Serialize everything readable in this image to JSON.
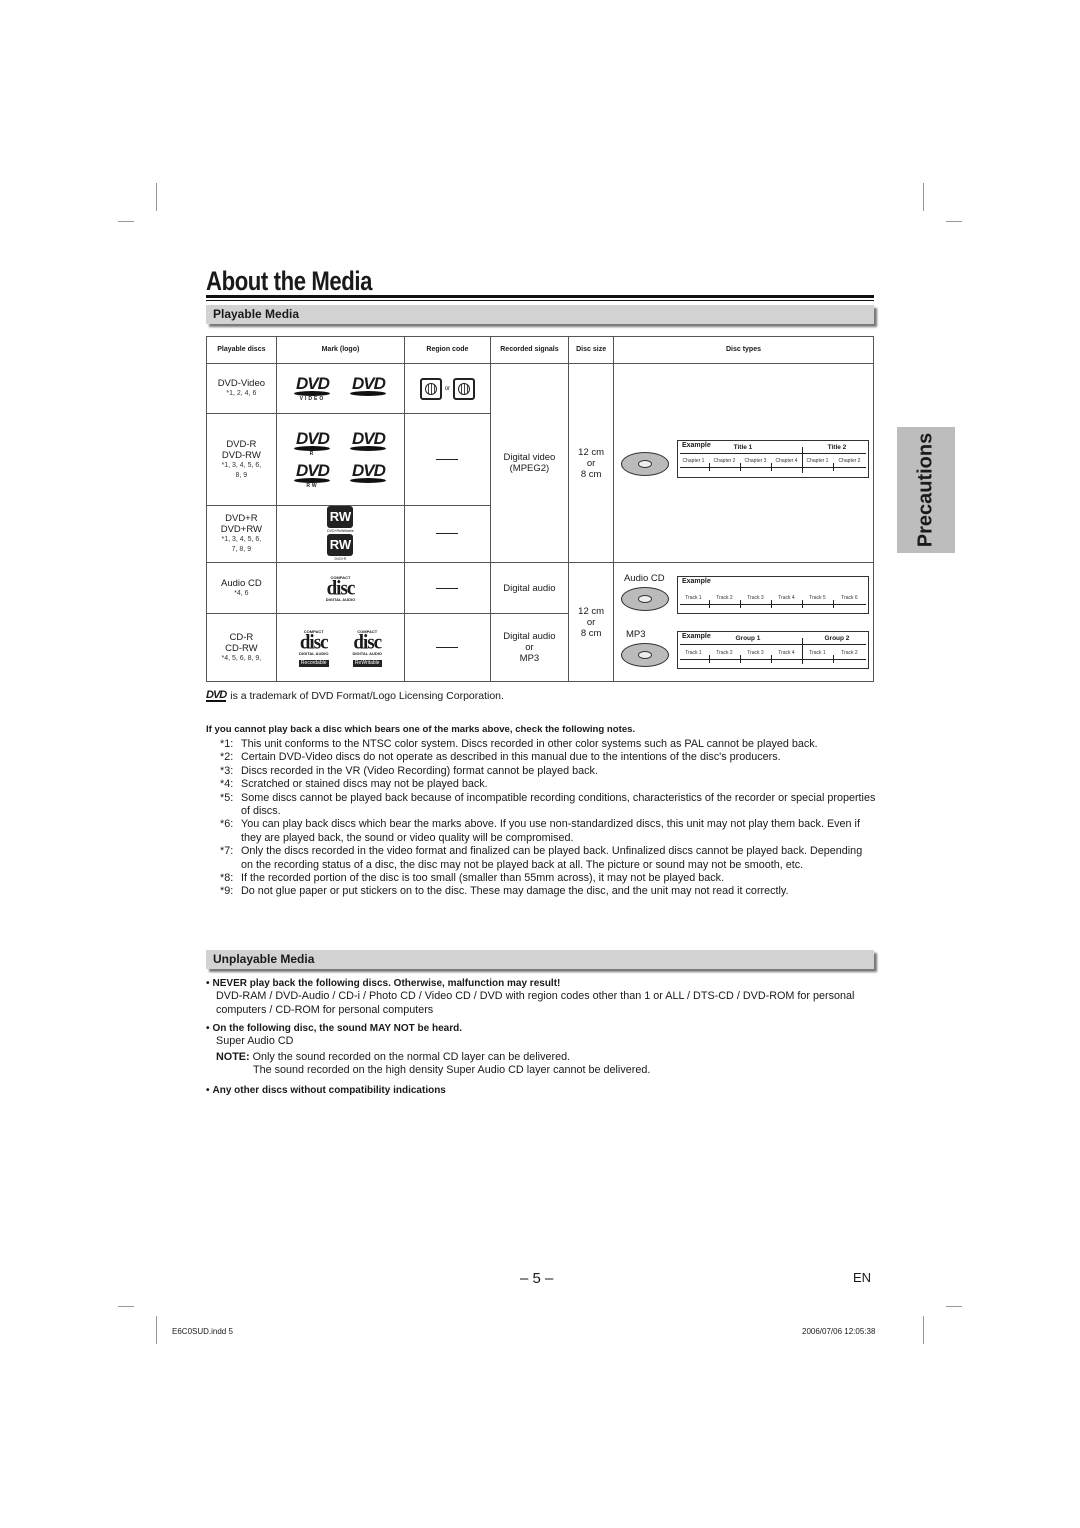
{
  "page": {
    "title": "About the Media",
    "side_tab": "Precautions",
    "page_number": "– 5 –",
    "language": "EN",
    "footer_file": "E6C0SUD.indd   5",
    "footer_timestamp": "2006/07/06   12:05:38"
  },
  "playable": {
    "heading": "Playable Media",
    "columns": [
      "Playable discs",
      "Mark (logo)",
      "Region code",
      "Recorded signals",
      "Disc size",
      "Disc types"
    ],
    "rows": [
      {
        "name": "DVD-Video",
        "notes": "*1, 2, 4, 6",
        "logos": [
          "DVD VIDEO",
          "DVD VIDEO"
        ],
        "region": [
          "1",
          "ALL"
        ],
        "region_or": "or"
      },
      {
        "name": "DVD-R\nDVD-RW",
        "name1": "DVD-R",
        "name2": "DVD-RW",
        "notes1": "*1, 3, 4, 5, 6,",
        "notes2": "8, 9",
        "logos": [
          "DVD R",
          "DVD R",
          "DVD RW",
          "DVD RW"
        ],
        "region": "—"
      },
      {
        "name1": "DVD+R",
        "name2": "DVD+RW",
        "notes1": "*1, 3, 4, 5, 6,",
        "notes2": "7, 8, 9",
        "logos": [
          "RW",
          "RW"
        ],
        "logo_captions": [
          "DVD+ReWritable",
          "DVD+R"
        ],
        "region": "—"
      },
      {
        "name": "Audio CD",
        "notes": "*4, 6",
        "logo": {
          "top": "COMPACT",
          "mid": "disc",
          "bottom": "DIGITAL AUDIO"
        },
        "region": "—",
        "signals": "Digital audio"
      },
      {
        "name1": "CD-R",
        "name2": "CD-RW",
        "notes": "*4, 5, 6, 8, 9,",
        "logos": [
          {
            "top": "COMPACT",
            "mid": "disc",
            "bottom": "DIGITAL AUDIO",
            "badge": "Recordable"
          },
          {
            "top": "COMPACT",
            "mid": "disc",
            "bottom": "DIGITAL AUDIO",
            "badge": "ReWritable"
          }
        ],
        "region": "—",
        "signals1": "Digital audio",
        "signals2": "or",
        "signals3": "MP3"
      }
    ],
    "dvd_signals": [
      "Digital video",
      "(MPEG2)"
    ],
    "dvd_size": [
      "12 cm",
      "or",
      "8 cm"
    ],
    "cd_size": [
      "12 cm",
      "or",
      "8 cm"
    ],
    "disc_types": {
      "dvd": {
        "example": "Example",
        "titles": [
          "Title 1",
          "Title 2"
        ],
        "chapters": [
          "Chapter 1",
          "Chapter 2",
          "Chapter 3",
          "Chapter 4",
          "Chapter 1",
          "Chapter 2"
        ]
      },
      "audio_cd": {
        "label": "Audio CD",
        "example": "Example",
        "tracks": [
          "Track 1",
          "Track 2",
          "Track 3",
          "Track 4",
          "Track 5",
          "Track 6"
        ]
      },
      "mp3": {
        "label": "MP3",
        "example": "Example",
        "groups": [
          "Group 1",
          "Group 2"
        ],
        "tracks": [
          "Track 1",
          "Track 2",
          "Track 3",
          "Track 4",
          "Track 1",
          "Track 2"
        ]
      }
    }
  },
  "trademark": "is a trademark of DVD Format/Logo Licensing Corporation.",
  "trademark_logo": "DVD",
  "notes_heading": "If you cannot play back a disc which bears one of the marks above, check the following notes.",
  "notes": [
    {
      "key": "*1:",
      "text": "This unit conforms to the NTSC color system. Discs recorded in other color systems such as PAL cannot be played back."
    },
    {
      "key": "*2:",
      "text": "Certain DVD-Video discs do not operate as described in this manual due to the intentions of the disc's producers."
    },
    {
      "key": "*3:",
      "text": "Discs recorded in the VR (Video Recording) format cannot be played back."
    },
    {
      "key": "*4:",
      "text": "Scratched or stained discs may not be played back."
    },
    {
      "key": "*5:",
      "text": "Some discs cannot be played back because of incompatible recording conditions, characteristics of the recorder or special properties of discs."
    },
    {
      "key": "*6:",
      "text": "You can play back discs which bear the marks above. If you use non-standardized discs, this unit may not play them back. Even if they are played back, the sound or video quality will be compromised."
    },
    {
      "key": "*7:",
      "text": "Only the discs recorded in the video format and finalized can be played back. Unfinalized discs cannot be played back. Depending on the recording status of a disc, the disc may not be played back at all. The picture or sound may not be smooth, etc."
    },
    {
      "key": "*8:",
      "text": "If the recorded portion of the disc is too small (smaller than 55mm across), it may not be played back."
    },
    {
      "key": "*9:",
      "text": "Do not glue paper or put stickers on to the disc. These may damage the disc, and the unit may not read it correctly."
    }
  ],
  "unplayable": {
    "heading": "Unplayable Media",
    "bullet1_bold": "NEVER play back the following discs. Otherwise, malfunction may result!",
    "bullet1_text": "DVD-RAM / DVD-Audio / CD-i / Photo CD / Video CD / DVD with region codes other than 1 or ALL / DTS-CD / DVD-ROM for personal computers / CD-ROM for personal computers",
    "bullet2_bold": "On the following disc, the sound MAY NOT be heard.",
    "bullet2_text": "Super Audio CD",
    "note_label": "NOTE:",
    "note_line1": "Only the sound recorded on the normal CD layer can be delivered.",
    "note_line2": "The sound recorded on the high density Super Audio CD layer cannot be delivered.",
    "bullet3_bold": "Any other discs without compatibility indications",
    "bullet_char": "•"
  }
}
